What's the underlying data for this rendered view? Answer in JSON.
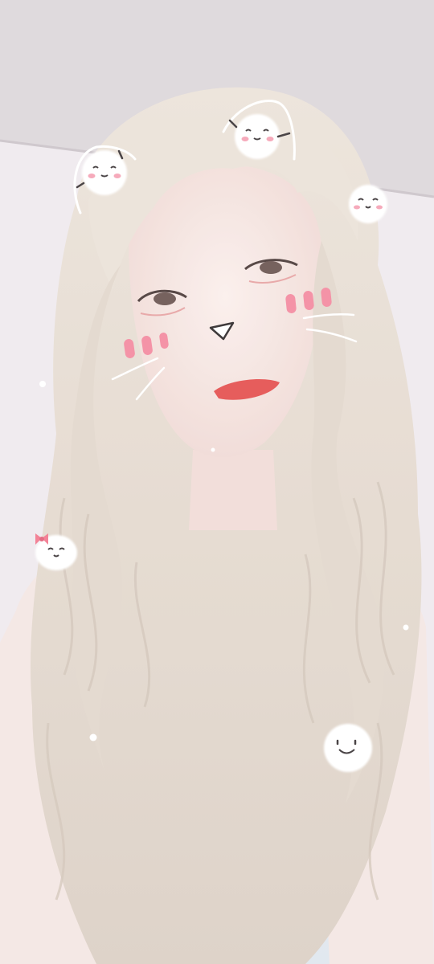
{
  "photo": {
    "subject": "",
    "palette": {
      "wall": "#efeaee",
      "ceiling": "#dcd6da",
      "hair": "#e7ddd3",
      "hair_shadow": "#cfc3b8",
      "skin": "#f6e6e2",
      "blush": "#f48aa0",
      "lips": "#e4504f",
      "dress": "#e8eef4",
      "sticker_white": "#ffffff",
      "sticker_line": "#3b3537",
      "sticker_cheek": "#f6a3b6",
      "bow": "#f2798f"
    }
  },
  "stickers": [
    {
      "icon": "round-white-creature",
      "has_ears": true,
      "cheeks": true
    },
    {
      "icon": "round-white-creature",
      "has_ears": true,
      "cheeks": true
    },
    {
      "icon": "round-white-creature",
      "has_ears": false,
      "cheeks": true
    },
    {
      "icon": "round-white-creature-with-bow",
      "has_ears": false,
      "cheeks": false
    },
    {
      "icon": "round-white-creature",
      "has_ears": false,
      "cheeks": false
    }
  ],
  "face_filter": {
    "nose_icon": "triangle-nose",
    "blush_marks": 3,
    "whiskers_per_side": 2
  }
}
